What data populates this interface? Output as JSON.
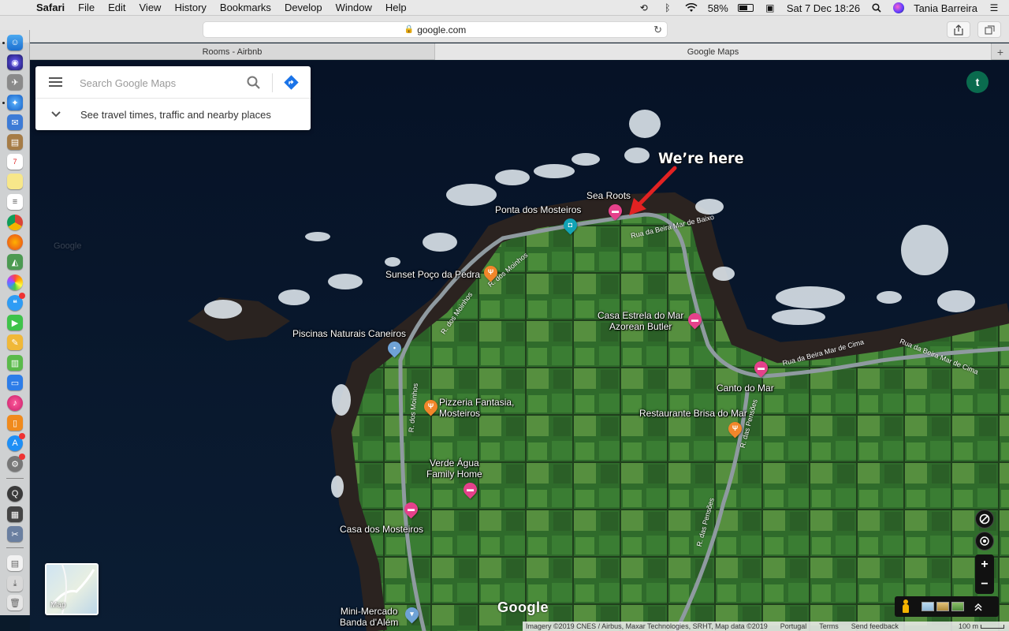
{
  "menubar": {
    "app": "Safari",
    "menus": [
      "File",
      "Edit",
      "View",
      "History",
      "Bookmarks",
      "Develop",
      "Window",
      "Help"
    ],
    "battery": "58%",
    "datetime": "Sat 7 Dec  18:26",
    "user": "Tania Barreira"
  },
  "browser": {
    "url": "google.com",
    "tabs": [
      "Rooms - Airbnb",
      "Google Maps"
    ],
    "new_tab": "+"
  },
  "search": {
    "placeholder": "Search Google Maps",
    "subtext": "See travel times, traffic and nearby places"
  },
  "account": {
    "initial": "t"
  },
  "annotation": {
    "text": "We’re here",
    "color": "#e22222"
  },
  "places": [
    {
      "name": "Sea Roots",
      "icon": "hotel-icon",
      "color": "#e5418b"
    },
    {
      "name": "Ponta dos Mosteiros",
      "icon": "camera-icon",
      "color": "#12a3b5"
    },
    {
      "name": "Sunset Poço da Pedra",
      "icon": "restaurant-icon",
      "color": "#f2862a"
    },
    {
      "name": "Piscinas Naturais Caneiros",
      "icon": "pin-icon",
      "color": "#6fa2d6"
    },
    {
      "name": "Casa Estrela do Mar\nAzorean Butler",
      "icon": "hotel-icon",
      "color": "#e5418b"
    },
    {
      "name": "Canto do Mar",
      "icon": "hotel-icon",
      "color": "#e5418b"
    },
    {
      "name": "Restaurante Brisa do Mar",
      "icon": "restaurant-icon",
      "color": "#f2862a"
    },
    {
      "name": "Pizzeria Fantasia,\nMosteiros",
      "icon": "restaurant-icon",
      "color": "#f2862a"
    },
    {
      "name": "Verde Água\nFamily Home",
      "icon": "hotel-icon",
      "color": "#e5418b"
    },
    {
      "name": "Casa dos Mosteiros",
      "icon": "hotel-icon",
      "color": "#e5418b"
    },
    {
      "name": "Mini-Mercado\nBanda d'Além",
      "icon": "shop-icon",
      "color": "#6fa2d6"
    }
  ],
  "streets": [
    "Rua da Beira Mar de Baixo",
    "R. dos Moinhos",
    "R. dos Moinhos",
    "R. dos Moinhos",
    "Rua da Beira Mar de Cima",
    "Rua da Beira Mar de Cima",
    "R. das Pensões",
    "R. das Pensões"
  ],
  "map_controls": {
    "map_toggle_label": "Map",
    "zoom_in": "+",
    "zoom_out": "−"
  },
  "google_logo": "Google",
  "attribution": {
    "imagery": "Imagery ©2019 CNES / Airbus, Maxar Technologies, SRHT, Map data ©2019",
    "country": "Portugal",
    "terms": "Terms",
    "feedback": "Send feedback",
    "scale": "100 m"
  }
}
